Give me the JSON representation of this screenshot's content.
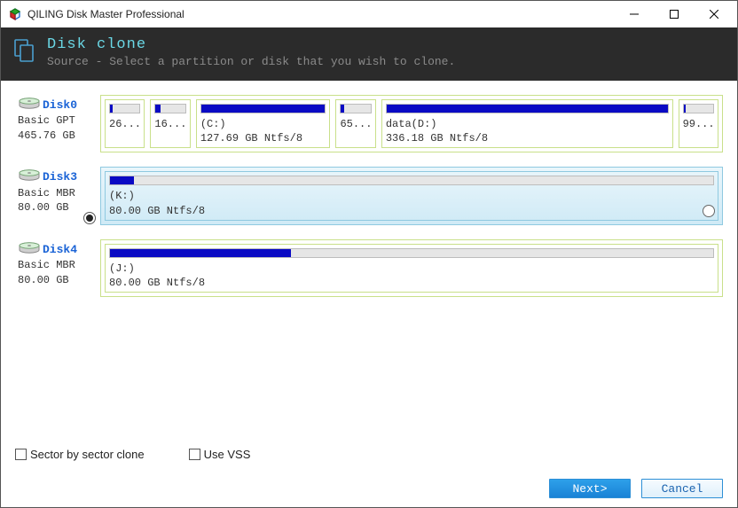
{
  "window": {
    "title": "QILING Disk Master Professional"
  },
  "header": {
    "title": "Disk clone",
    "subtitle": "Source - Select a partition or disk that you wish to clone."
  },
  "disks": [
    {
      "name": "Disk0",
      "type": "Basic GPT",
      "size": "465.76 GB",
      "selected": false,
      "show_radio": false,
      "partitions": [
        {
          "label": "",
          "detail": "26...",
          "fill": 10,
          "flex": 1
        },
        {
          "label": "",
          "detail": "16...",
          "fill": 18,
          "flex": 1
        },
        {
          "label": "(C:)",
          "detail": "127.69 GB Ntfs/8",
          "fill": 100,
          "flex": 4
        },
        {
          "label": "",
          "detail": "65...",
          "fill": 12,
          "flex": 1
        },
        {
          "label": "data(D:)",
          "detail": "336.18 GB Ntfs/8",
          "fill": 100,
          "flex": 9
        },
        {
          "label": "",
          "detail": "99...",
          "fill": 8,
          "flex": 1
        }
      ]
    },
    {
      "name": "Disk3",
      "type": "Basic MBR",
      "size": "80.00 GB",
      "selected": true,
      "show_radio": true,
      "partitions": [
        {
          "label": "(K:)",
          "detail": "80.00 GB Ntfs/8",
          "fill": 4,
          "flex": 1
        }
      ]
    },
    {
      "name": "Disk4",
      "type": "Basic MBR",
      "size": "80.00 GB",
      "selected": false,
      "show_radio": false,
      "partitions": [
        {
          "label": "(J:)",
          "detail": "80.00 GB Ntfs/8",
          "fill": 30,
          "flex": 1
        }
      ]
    }
  ],
  "options": {
    "sector_label": "Sector by sector clone",
    "vss_label": "Use VSS",
    "sector_checked": false,
    "vss_checked": false
  },
  "buttons": {
    "next": "Next>",
    "cancel": "Cancel"
  }
}
